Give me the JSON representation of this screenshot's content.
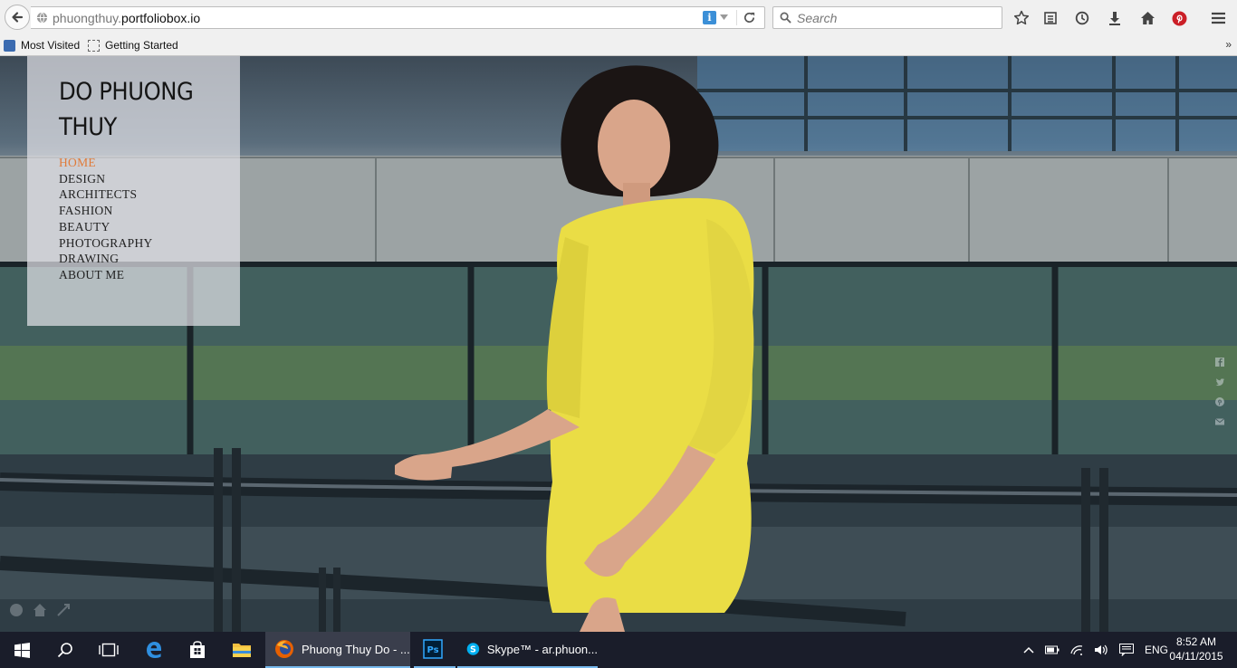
{
  "browser": {
    "url_prefix": "phuongthuy.",
    "url_host": "portfoliobox.io",
    "search_placeholder": "Search",
    "bookmarks": [
      {
        "label": "Most Visited",
        "icon": "most-visited-icon"
      },
      {
        "label": "Getting Started",
        "icon": "page-icon"
      }
    ],
    "bookmarks_more": "»"
  },
  "site": {
    "title": "DO PHUONG THUY",
    "nav": [
      "HOME",
      "DESIGN",
      "ARCHITECTS",
      "FASHION",
      "BEAUTY",
      "PHOTOGRAPHY",
      "DRAWING",
      "ABOUT ME"
    ],
    "active_nav": "HOME",
    "accent_color": "#e07b39"
  },
  "taskbar": {
    "tasks": [
      {
        "label": "Phuong Thuy Do - ...",
        "icon": "firefox-icon",
        "state": "active"
      },
      {
        "label": "",
        "icon": "photoshop-icon",
        "state": "running"
      },
      {
        "label": "Skype™ - ar.phuon...",
        "icon": "skype-icon",
        "state": "running"
      }
    ],
    "language": "ENG",
    "time": "8:52 AM",
    "date": "04/11/2015"
  }
}
